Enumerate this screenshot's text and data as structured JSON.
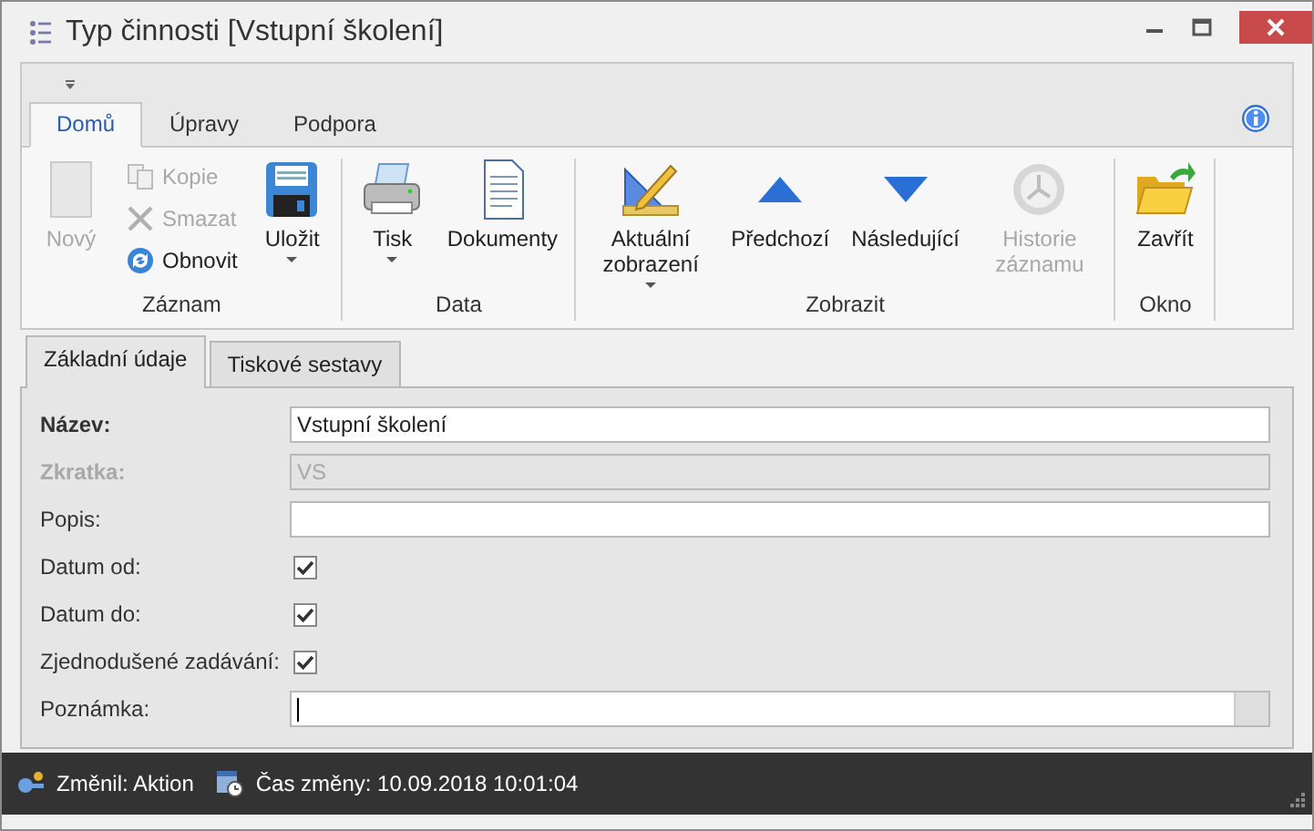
{
  "window": {
    "title": "Typ činnosti [Vstupní školení]"
  },
  "ribbon": {
    "tabs": [
      {
        "label": "Domů",
        "selected": true
      },
      {
        "label": "Úpravy",
        "selected": false
      },
      {
        "label": "Podpora",
        "selected": false
      }
    ],
    "groups": [
      {
        "label": "Záznam",
        "items": [
          {
            "label": "Nový",
            "kind": "large",
            "disabled": true,
            "dropdown": false
          },
          {
            "label": "Kopie",
            "kind": "small",
            "disabled": true
          },
          {
            "label": "Smazat",
            "kind": "small",
            "disabled": true
          },
          {
            "label": "Obnovit",
            "kind": "small",
            "disabled": false
          },
          {
            "label": "Uložit",
            "kind": "large",
            "disabled": false,
            "dropdown": true
          }
        ]
      },
      {
        "label": "Data",
        "items": [
          {
            "label": "Tisk",
            "kind": "large",
            "disabled": false,
            "dropdown": true
          },
          {
            "label": "Dokumenty",
            "kind": "large",
            "disabled": false,
            "dropdown": false
          }
        ]
      },
      {
        "label": "Zobrazit",
        "items": [
          {
            "label": "Aktuální zobrazení",
            "kind": "large",
            "disabled": false,
            "dropdown": true
          },
          {
            "label": "Předchozí",
            "kind": "large",
            "disabled": false,
            "dropdown": false
          },
          {
            "label": "Následující",
            "kind": "large",
            "disabled": false,
            "dropdown": false
          },
          {
            "label": "Historie záznamu",
            "kind": "large",
            "disabled": true,
            "dropdown": false
          }
        ]
      },
      {
        "label": "Okno",
        "items": [
          {
            "label": "Zavřít",
            "kind": "large",
            "disabled": false,
            "dropdown": false
          }
        ]
      }
    ]
  },
  "form": {
    "tabs": [
      {
        "label": "Základní údaje",
        "selected": true
      },
      {
        "label": "Tiskové sestavy",
        "selected": false
      }
    ],
    "fields": [
      {
        "label": "Název:",
        "kind": "text",
        "value": "Vstupní školení",
        "required": true,
        "disabled": false
      },
      {
        "label": "Zkratka:",
        "kind": "text",
        "value": "VS",
        "required": true,
        "disabled": true
      },
      {
        "label": "Popis:",
        "kind": "text",
        "required": false,
        "disabled": false
      },
      {
        "label": "Datum od:",
        "kind": "checkbox",
        "checked": true
      },
      {
        "label": "Datum do:",
        "kind": "checkbox",
        "checked": true
      },
      {
        "label": "Zjednodušené zadávání:",
        "kind": "checkbox",
        "checked": true
      },
      {
        "label": "Poznámka:",
        "kind": "memo",
        "required": false,
        "disabled": false,
        "focused": true
      }
    ]
  },
  "status_bar": [
    {
      "text": "Změnil: Aktion"
    },
    {
      "text": "Čas změny: 10.09.2018 10:01:04"
    }
  ]
}
